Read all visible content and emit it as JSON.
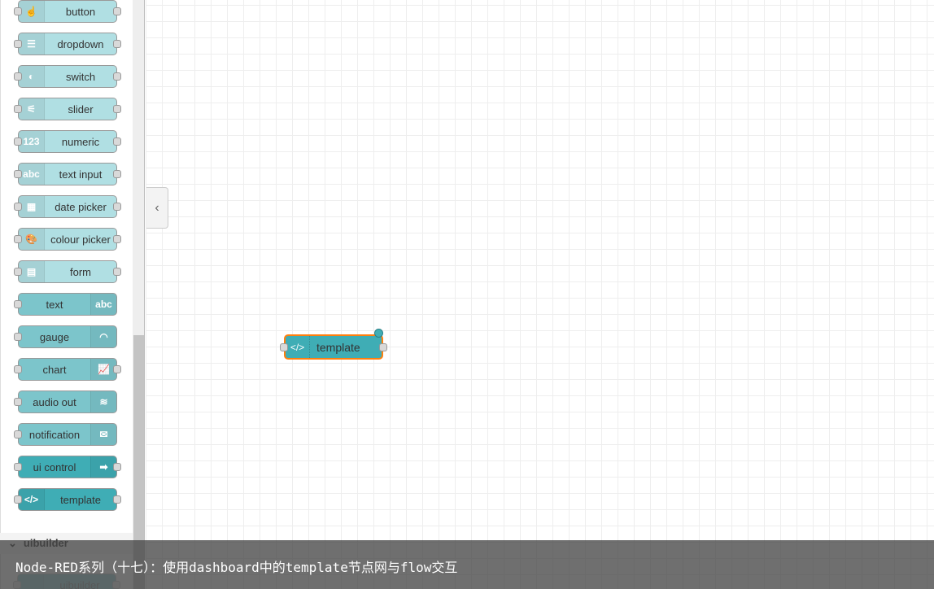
{
  "palette": {
    "nodes": [
      {
        "label": "button",
        "icon": "hand-icon",
        "glyph": "☝",
        "shade": "light",
        "icon_side": "left",
        "input": true,
        "output": true
      },
      {
        "label": "dropdown",
        "icon": "list-icon",
        "glyph": "☰",
        "shade": "light",
        "icon_side": "left",
        "input": true,
        "output": true
      },
      {
        "label": "switch",
        "icon": "toggle-icon",
        "glyph": "◐",
        "shade": "light",
        "icon_side": "left",
        "input": true,
        "output": true
      },
      {
        "label": "slider",
        "icon": "sliders-icon",
        "glyph": "⚟",
        "shade": "light",
        "icon_side": "left",
        "input": true,
        "output": true
      },
      {
        "label": "numeric",
        "icon": "numeric-icon",
        "glyph": "123",
        "shade": "light",
        "icon_side": "left",
        "input": true,
        "output": true
      },
      {
        "label": "text input",
        "icon": "abc-icon",
        "glyph": "abc",
        "shade": "light",
        "icon_side": "left",
        "input": true,
        "output": true
      },
      {
        "label": "date picker",
        "icon": "calendar-icon",
        "glyph": "▦",
        "shade": "light",
        "icon_side": "left",
        "input": true,
        "output": true
      },
      {
        "label": "colour picker",
        "icon": "palette-icon",
        "glyph": "🎨",
        "shade": "light",
        "icon_side": "left",
        "input": true,
        "output": true
      },
      {
        "label": "form",
        "icon": "form-icon",
        "glyph": "▤",
        "shade": "light",
        "icon_side": "left",
        "input": true,
        "output": true
      },
      {
        "label": "text",
        "icon": "abc-icon",
        "glyph": "abc",
        "shade": "mid",
        "icon_side": "right",
        "input": true,
        "output": false
      },
      {
        "label": "gauge",
        "icon": "gauge-icon",
        "glyph": "◠",
        "shade": "mid",
        "icon_side": "right",
        "input": true,
        "output": false
      },
      {
        "label": "chart",
        "icon": "line-chart-icon",
        "glyph": "📈",
        "shade": "mid",
        "icon_side": "right",
        "input": true,
        "output": true
      },
      {
        "label": "audio out",
        "icon": "audio-icon",
        "glyph": "≋",
        "shade": "mid",
        "icon_side": "right",
        "input": true,
        "output": false
      },
      {
        "label": "notification",
        "icon": "envelope-icon",
        "glyph": "✉",
        "shade": "mid",
        "icon_side": "right",
        "input": true,
        "output": false
      },
      {
        "label": "ui control",
        "icon": "arrow-right-icon",
        "glyph": "➡",
        "shade": "dark",
        "icon_side": "right",
        "input": true,
        "output": true
      },
      {
        "label": "template",
        "icon": "code-icon",
        "glyph": "</>",
        "shade": "dark",
        "icon_side": "left",
        "input": true,
        "output": true
      }
    ],
    "category": {
      "label": "uibuilder",
      "chevron": "⌄"
    },
    "next_node": {
      "label": "uibuilder"
    }
  },
  "canvas": {
    "collapse_glyph": "‹",
    "flow_node": {
      "label": "template",
      "icon": "code-icon",
      "glyph": "</>"
    }
  },
  "caption": "Node-RED系列（十七）：使用dashboard中的template节点网与flow交互",
  "colors": {
    "light": "#b0dfe3",
    "mid": "#7cc5cb",
    "dark": "#3fadb5",
    "selected": "#ff7f0e"
  }
}
